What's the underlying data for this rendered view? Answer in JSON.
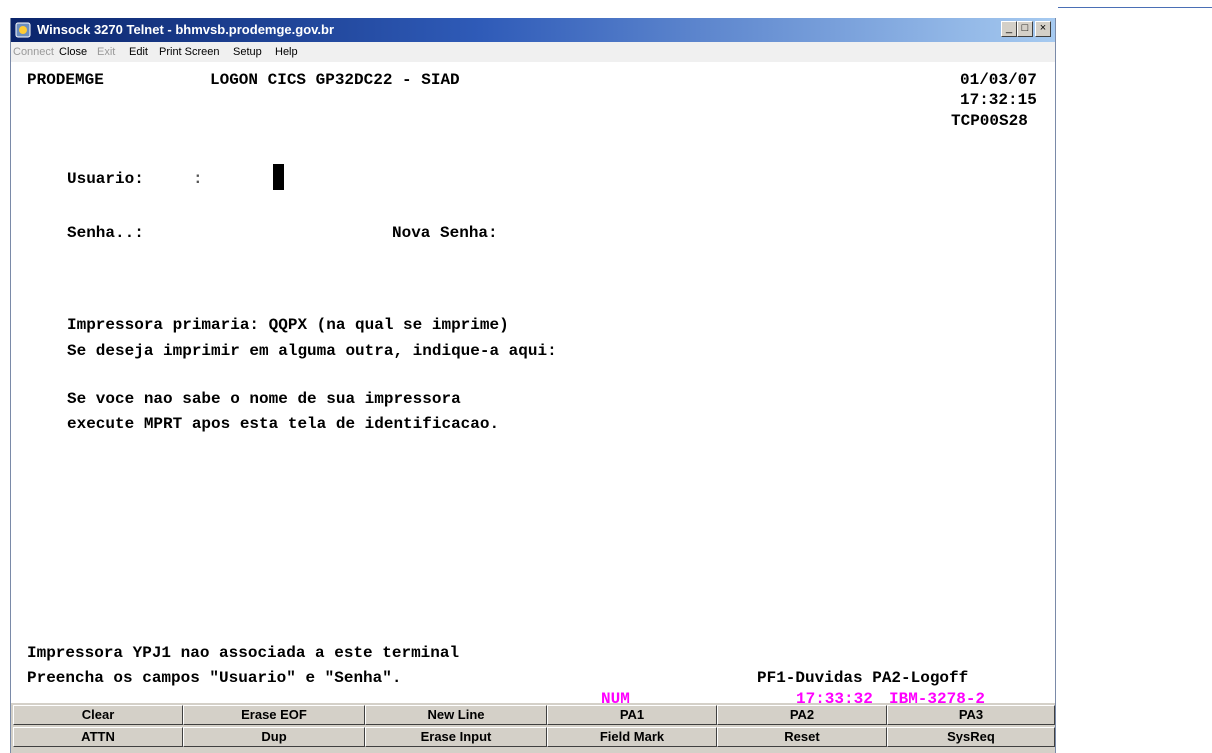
{
  "window": {
    "title": "Winsock 3270 Telnet - bhmvsb.prodemge.gov.br",
    "controls": {
      "minimize": "_",
      "maximize": "□",
      "close": "×"
    }
  },
  "menu": {
    "items": [
      {
        "label": "Connect",
        "disabled": true
      },
      {
        "label": "Close",
        "disabled": false
      },
      {
        "label": "Exit",
        "disabled": true
      },
      {
        "label": "Edit",
        "disabled": false
      },
      {
        "label": "Print Screen",
        "disabled": false
      },
      {
        "label": "Setup",
        "disabled": false
      },
      {
        "label": "Help",
        "disabled": false
      }
    ]
  },
  "screen": {
    "org": "PRODEMGE",
    "header": "LOGON CICS GP32DC22 - SIAD",
    "date": "01/03/07",
    "time": "17:32:15",
    "terminal_id": "TCP00S28",
    "usuario_label": "Usuario:",
    "usuario_sep": ":",
    "senha_label": "Senha..:",
    "nova_senha_label": "Nova Senha:",
    "printer_line1": "Impressora primaria: QQPX (na qual se imprime)",
    "printer_line2": "Se deseja imprimir em alguma outra, indique-a aqui:",
    "help_line1": "Se voce nao sabe o nome de sua impressora",
    "help_line2": "execute MPRT apos esta tela de identificacao.",
    "status_msg1": "Impressora YPJ1 nao associada a este terminal",
    "status_msg2": "Preencha os campos \"Usuario\" e \"Senha\".",
    "pf_hint": "PF1-Duvidas PA2-Logoff",
    "oia_num": "NUM",
    "oia_time": "17:33:32",
    "oia_model": "IBM-3278-2"
  },
  "keys": {
    "row1": [
      "Clear",
      "Erase EOF",
      "New Line",
      "PA1",
      "PA2",
      "PA3"
    ],
    "row2": [
      "ATTN",
      "Dup",
      "Erase Input",
      "Field Mark",
      "Reset",
      "SysReq"
    ]
  },
  "colors": {
    "title_bar": "#0a246a",
    "oia_text": "#ff00ff",
    "key_face": "#d4d0c8"
  }
}
